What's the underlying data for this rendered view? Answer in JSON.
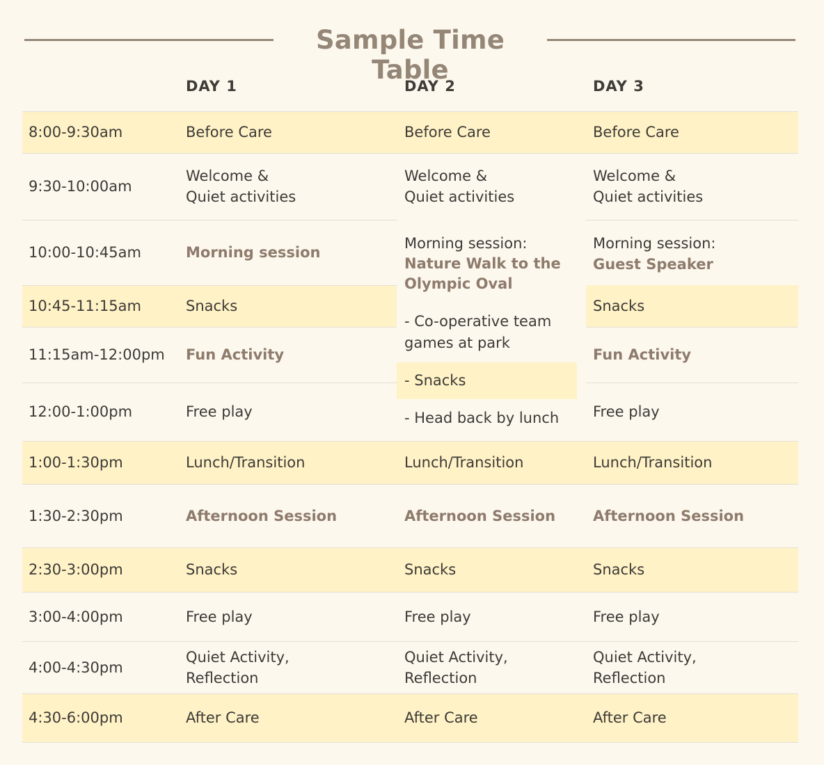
{
  "title": "Sample Time Table",
  "days": [
    "DAY 1",
    "DAY 2",
    "DAY 3"
  ],
  "times": [
    "8:00-9:30am",
    "9:30-10:00am",
    "10:00-10:45am",
    "10:45-11:15am",
    "11:15am-12:00pm",
    "12:00-1:00pm",
    "1:00-1:30pm",
    "1:30-2:30pm",
    "2:30-3:00pm",
    "3:00-4:00pm",
    "4:00-4:30pm",
    "4:30-6:00pm"
  ],
  "day1": [
    "Before Care",
    [
      "Welcome &",
      "Quiet activities"
    ],
    "Morning session",
    "Snacks",
    "Fun Activity",
    "Free play",
    "Lunch/Transition",
    "Afternoon Session",
    "Snacks",
    "Free play",
    [
      "Quiet Activity,",
      "Reflection"
    ],
    "After Care"
  ],
  "day2": {
    "before_care": "Before Care",
    "welcome": [
      "Welcome &",
      "Quiet activities"
    ],
    "morning_label": "Morning session:",
    "morning_title": [
      "Nature Walk to the",
      "Olympic Oval"
    ],
    "steps": [
      [
        "- Co-operative team",
        "games at park"
      ],
      "- Snacks",
      "- Head back by lunch"
    ],
    "lunch": "Lunch/Transition",
    "afternoon": "Afternoon Session",
    "snacks": "Snacks",
    "free_play": "Free play",
    "quiet": [
      "Quiet Activity,",
      "Reflection"
    ],
    "after_care": "After Care"
  },
  "day3": [
    "Before Care",
    [
      "Welcome &",
      "Quiet activities"
    ],
    "Morning session:",
    "Guest Speaker",
    "Snacks",
    "Fun Activity",
    "Free play",
    "Lunch/Transition",
    "Afternoon Session",
    "Snacks",
    "Free play",
    [
      "Quiet Activity,",
      "Reflection"
    ],
    "After Care"
  ],
  "colors": {
    "highlight": "#fff2c6",
    "accent": "#8e7b6c",
    "title": "#958777",
    "background": "#fdf8ee"
  }
}
